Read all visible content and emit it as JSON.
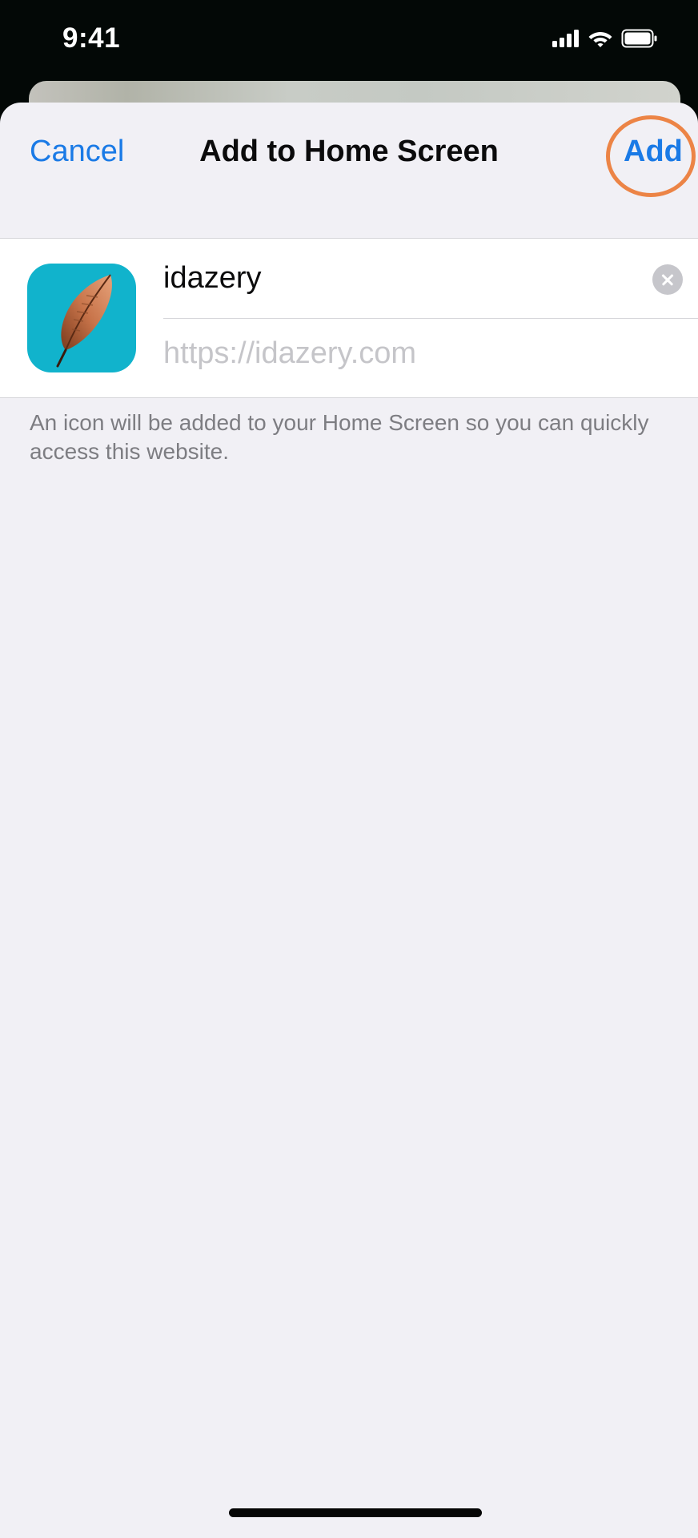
{
  "status_bar": {
    "time": "9:41",
    "icons": [
      "cellular-signal-icon",
      "wifi-icon",
      "battery-icon"
    ]
  },
  "nav": {
    "cancel_label": "Cancel",
    "title": "Add to Home Screen",
    "add_label": "Add"
  },
  "form": {
    "name_value": "idazery",
    "url": "https://idazery.com",
    "icon": "feather-app-icon"
  },
  "footer_note": "An icon will be added to your Home Screen so you can quickly access this website.",
  "colors": {
    "accent": "#1a7ae6",
    "highlight": "#ec8446",
    "sheet_background": "#f1f0f5",
    "app_icon_background": "#11b3cc",
    "feather": "#c8744a"
  }
}
